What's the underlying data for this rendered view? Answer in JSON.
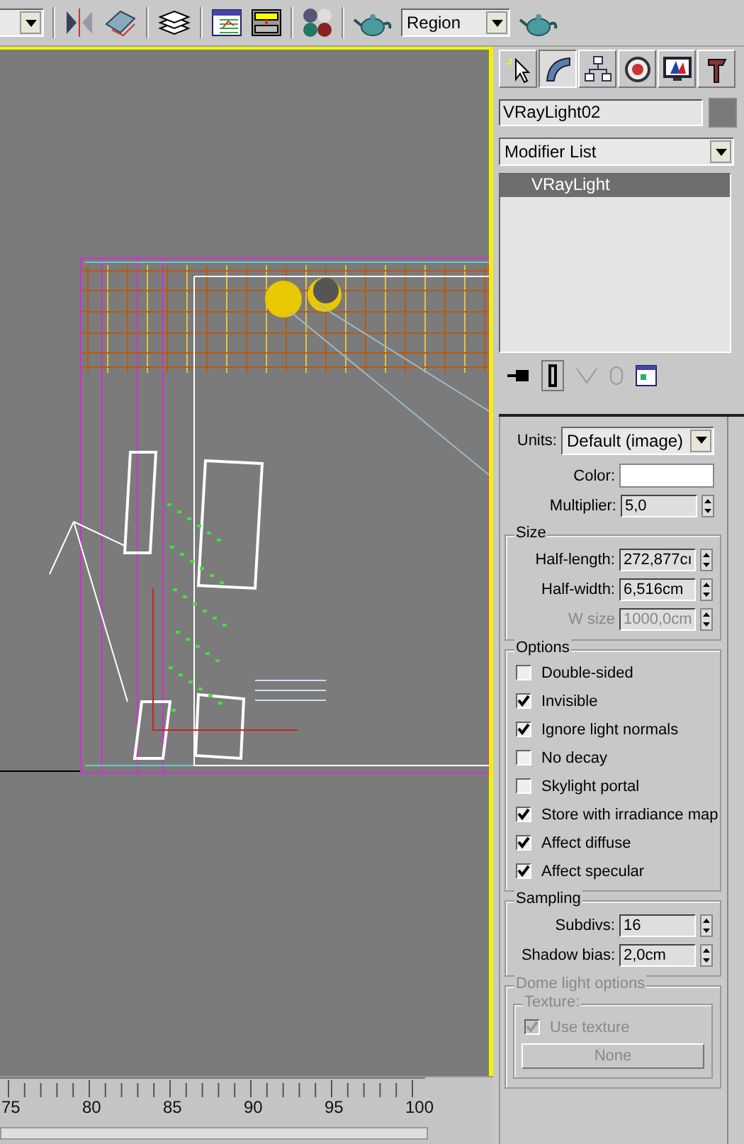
{
  "toolbar": {
    "region_dropdown": {
      "value": "Region"
    }
  },
  "timeline": {
    "ticks": [
      "75",
      "80",
      "85",
      "90",
      "95",
      "100"
    ]
  },
  "command_panel": {
    "tabs": [
      {
        "kind": "create",
        "selected": false
      },
      {
        "kind": "modify",
        "selected": true
      },
      {
        "kind": "hierarchy",
        "selected": false
      },
      {
        "kind": "motion",
        "selected": false
      },
      {
        "kind": "display",
        "selected": false
      },
      {
        "kind": "utilities",
        "selected": false
      }
    ],
    "object_name": "VRayLight02",
    "modifier_list": "Modifier List",
    "stack": [
      {
        "label": "VRayLight",
        "selected": true
      }
    ],
    "parameters": {
      "units": {
        "label": "Units:",
        "value": "Default (image)"
      },
      "color": {
        "label": "Color:",
        "color": "#ffffff"
      },
      "multiplier": {
        "label": "Multiplier:",
        "value": "5,0"
      },
      "size": {
        "title": "Size",
        "fields": [
          {
            "label": "Half-length:",
            "value": "272,877cı",
            "disabled": false
          },
          {
            "label": "Half-width:",
            "value": "6,516cm",
            "disabled": false
          },
          {
            "label": "W size",
            "value": "1000,0cm",
            "disabled": true
          }
        ]
      },
      "options": {
        "title": "Options",
        "items": [
          {
            "label": "Double-sided",
            "checked": false
          },
          {
            "label": "Invisible",
            "checked": true
          },
          {
            "label": "Ignore light normals",
            "checked": true
          },
          {
            "label": "No decay",
            "checked": false
          },
          {
            "label": "Skylight portal",
            "checked": false
          },
          {
            "label": "Store with irradiance map",
            "checked": true
          },
          {
            "label": "Affect diffuse",
            "checked": true
          },
          {
            "label": "Affect specular",
            "checked": true
          }
        ]
      },
      "sampling": {
        "title": "Sampling",
        "fields": [
          {
            "label": "Subdivs:",
            "value": "16",
            "disabled": false
          },
          {
            "label": "Shadow bias:",
            "value": "2,0cm",
            "disabled": false
          }
        ]
      },
      "dome": {
        "title": "Dome light options",
        "disabled": true,
        "texture": {
          "title": "Texture:",
          "use_texture": {
            "label": "Use texture",
            "checked": true
          },
          "button": "None"
        }
      }
    }
  }
}
